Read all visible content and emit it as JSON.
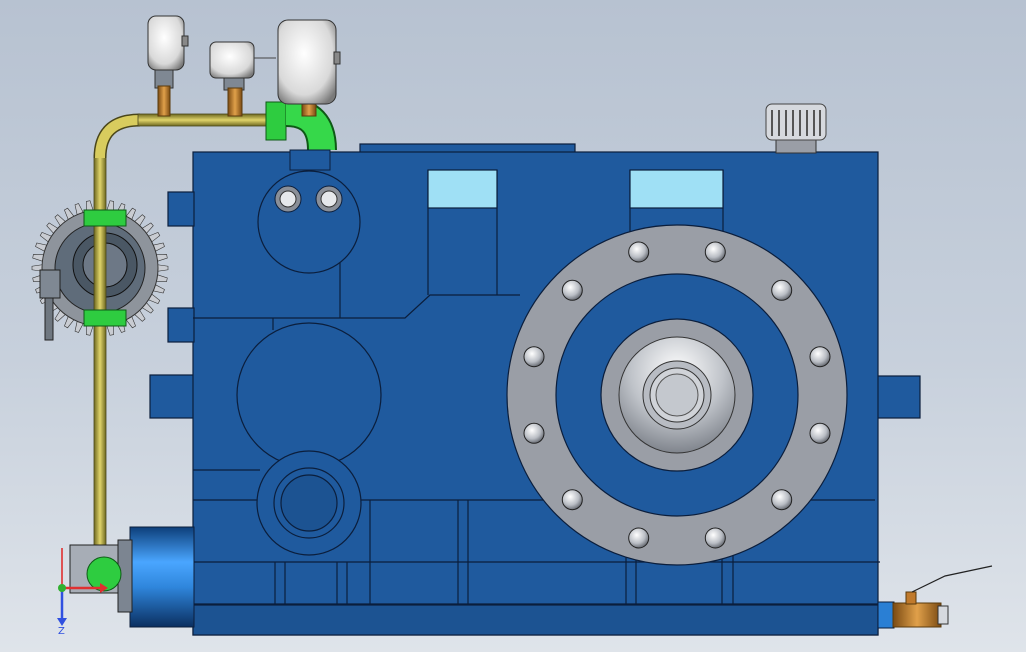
{
  "viewport": {
    "background": [
      "#b7c2d1",
      "#dfe4ea"
    ]
  },
  "colors": {
    "housing": "#1f5a9e",
    "housing_edge": "#0b1e3c",
    "window": "#9fe0f5",
    "flange": "#9a9ea6",
    "bolt": "#d8dbe0",
    "pipe": "#b5a93a",
    "pipe_fitting": "#2ecc40",
    "brass": "#c07a2c",
    "gauge_face": "#f2f2f2",
    "motor": "#2a7fd4",
    "axis_x": "#e03030",
    "axis_y": "#30b030",
    "axis_z": "#3050e0"
  },
  "components": [
    {
      "name": "gearbox-housing"
    },
    {
      "name": "output-flange",
      "bolt_count": 12
    },
    {
      "name": "pressure-gauge",
      "count": 3
    },
    {
      "name": "lubrication-pipe"
    },
    {
      "name": "oil-pump-gear"
    },
    {
      "name": "motor"
    },
    {
      "name": "breather-cap"
    },
    {
      "name": "drain-valve"
    }
  ],
  "triad": {
    "z_label": "Z"
  }
}
